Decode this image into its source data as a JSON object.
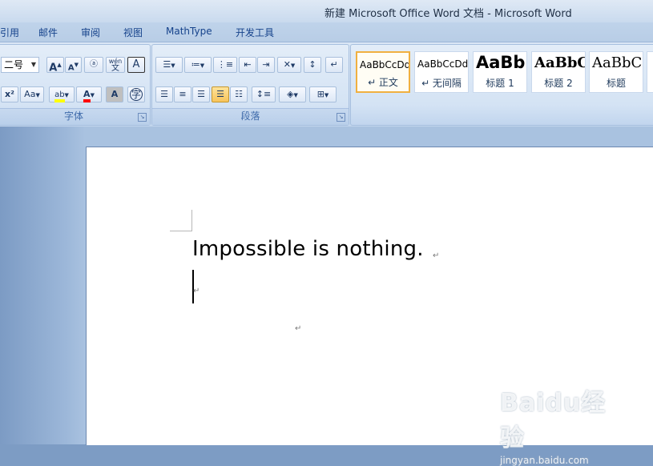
{
  "window": {
    "title": "新建 Microsoft Office Word 文档 - Microsoft Word"
  },
  "tabs": [
    "引用",
    "邮件",
    "审阅",
    "视图",
    "MathType",
    "开发工具"
  ],
  "ribbon": {
    "font_group": {
      "label": "字体",
      "font_size": "二号",
      "grow_font": "A",
      "shrink_font": "A",
      "phonetic_guide": "wén",
      "char_border": "A",
      "superscript": "x²",
      "change_case": "Aa",
      "highlight": "ab",
      "font_color": "A",
      "char_shading": "A",
      "enclose_char": "字"
    },
    "paragraph_group": {
      "label": "段落"
    },
    "styles": [
      {
        "sample": "AaBbCcDd",
        "name": "↵ 正文",
        "selected": true
      },
      {
        "sample": "AaBbCcDd",
        "name": "↵ 无间隔",
        "selected": false
      },
      {
        "sample": "AaBb",
        "name": "标题 1",
        "selected": false
      },
      {
        "sample": "AaBbC",
        "name": "标题 2",
        "selected": false
      },
      {
        "sample": "AaBbC",
        "name": "标题",
        "selected": false
      }
    ]
  },
  "document": {
    "line1": "Impossible is nothing.",
    "paragraph_mark": "↵"
  },
  "watermark": {
    "brand": "Baidu经验",
    "url": "jingyan.baidu.com"
  },
  "colors": {
    "highlight": "#ffff00",
    "font_color": "#ff0000",
    "selected_style_border": "#f0b040"
  }
}
